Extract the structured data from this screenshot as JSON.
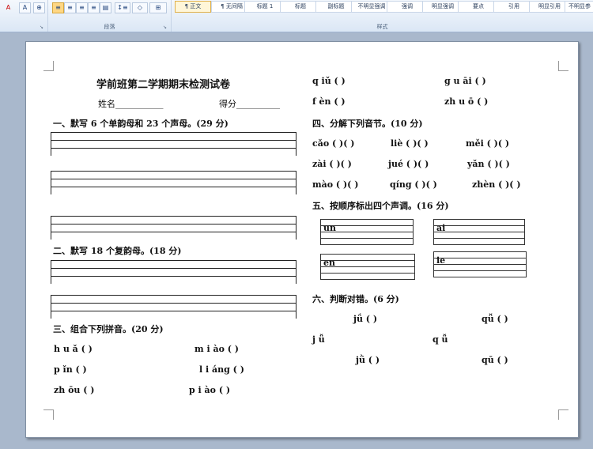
{
  "ribbon": {
    "font_color_icon": "A",
    "font_a_icon": "A",
    "paragraph_group_label": "段落",
    "styles_group_label": "样式",
    "styles": [
      "¶ 正文",
      "¶ 无间隔",
      "标题 1",
      "标题",
      "副标题",
      "不明显强调",
      "强调",
      "明显强调",
      "要点",
      "引用",
      "明显引用",
      "不明显参"
    ]
  },
  "doc": {
    "title": "学前班第二学期期末检测试卷",
    "name_label": "姓名___________",
    "score_label": "得分__________",
    "sec1": "一、默写 6 个单韵母和 23 个声母。(29 分)",
    "sec2": "二、默写 18 个复韵母。(18 分)",
    "sec3": "三、组合下列拼音。(20 分)",
    "sec3_items": [
      "h  u  ǎ   (    )",
      "m   i  ào  (    )",
      "p   ǐn    (    )",
      "l   i  áng  (    )",
      "zh    ōu   (    )",
      "p   i   ào   (    )"
    ],
    "r_top": [
      "q       iǔ   (     )",
      "g    u   āi  (     )",
      "f      èn   (     )",
      "zh    u    ō   (     )"
    ],
    "sec4": "四、分解下列音节。(10 分)",
    "sec4_items": [
      "cǎo  (   )(   )",
      "liè  (   )(   )",
      "měi   (   )(   )",
      "zài   (   )(   )",
      "jué   (   )(   )",
      "yǎn   (   )(   )",
      "mào   (   )(   )",
      "qíng   (   )(   )",
      "zhèn   (   )(  )"
    ],
    "sec5": "五、按顺序标出四个声调。(16 分)",
    "sec5_boxes": [
      "un",
      "ai",
      "en",
      "ie"
    ],
    "sec6": "六、判断对错。(6 分)",
    "sec6_items": [
      "jǘ (     )",
      "qǚ (     )",
      "j    ǚ",
      "q    ǚ",
      "jǜ (     )",
      "qū (     )"
    ]
  }
}
